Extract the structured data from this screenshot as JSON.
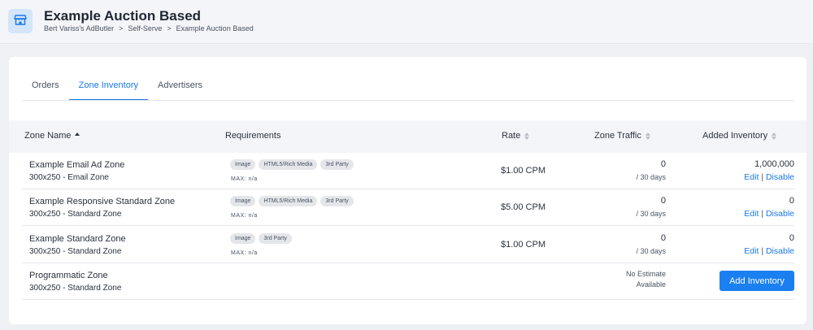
{
  "header": {
    "icon": "store-icon",
    "title": "Example Auction Based",
    "breadcrumb": [
      "Bert Variss's AdButler",
      "Self-Serve",
      "Example Auction Based"
    ],
    "breadcrumb_separator": ">"
  },
  "tabs": [
    {
      "label": "Orders",
      "active": false
    },
    {
      "label": "Zone Inventory",
      "active": true
    },
    {
      "label": "Advertisers",
      "active": false
    }
  ],
  "table": {
    "columns": [
      {
        "label": "Zone Name",
        "sort": "asc"
      },
      {
        "label": "Requirements",
        "sort": null
      },
      {
        "label": "Rate",
        "sort": "none"
      },
      {
        "label": "Zone Traffic",
        "sort": "none"
      },
      {
        "label": "Added Inventory",
        "sort": "none"
      }
    ],
    "rows": [
      {
        "name": "Example Email Ad Zone",
        "sub": "300x250 - Email Zone",
        "requirements": [
          "Image",
          "HTML5/Rich Media",
          "3rd Party"
        ],
        "max": "MAX: n/a",
        "rate": "$1.00 CPM",
        "traffic": "0",
        "traffic_period": "/ 30 days",
        "inventory": "1,000,000",
        "edit": "Edit",
        "disable": "Disable"
      },
      {
        "name": "Example Responsive Standard Zone",
        "sub": "300x250 - Standard Zone",
        "requirements": [
          "Image",
          "HTML5/Rich Media",
          "3rd Party"
        ],
        "max": "MAX: n/a",
        "rate": "$5.00 CPM",
        "traffic": "0",
        "traffic_period": "/ 30 days",
        "inventory": "0",
        "edit": "Edit",
        "disable": "Disable"
      },
      {
        "name": "Example Standard Zone",
        "sub": "300x250 - Standard Zone",
        "requirements": [
          "Image",
          "3rd Party"
        ],
        "max": "MAX: n/a",
        "rate": "$1.00 CPM",
        "traffic": "0",
        "traffic_period": "/ 30 days",
        "inventory": "0",
        "edit": "Edit",
        "disable": "Disable"
      },
      {
        "name": "Programmatic Zone",
        "sub": "300x250 - Standard Zone",
        "no_estimate": "No Estimate Available",
        "button": "Add Inventory"
      }
    ],
    "link_separator": "|"
  },
  "colors": {
    "accent": "#1a78e6",
    "button": "#1a7ff0",
    "background": "#eef0f4",
    "chip": "#e4e6ea",
    "badge": "#d3e6fb"
  }
}
